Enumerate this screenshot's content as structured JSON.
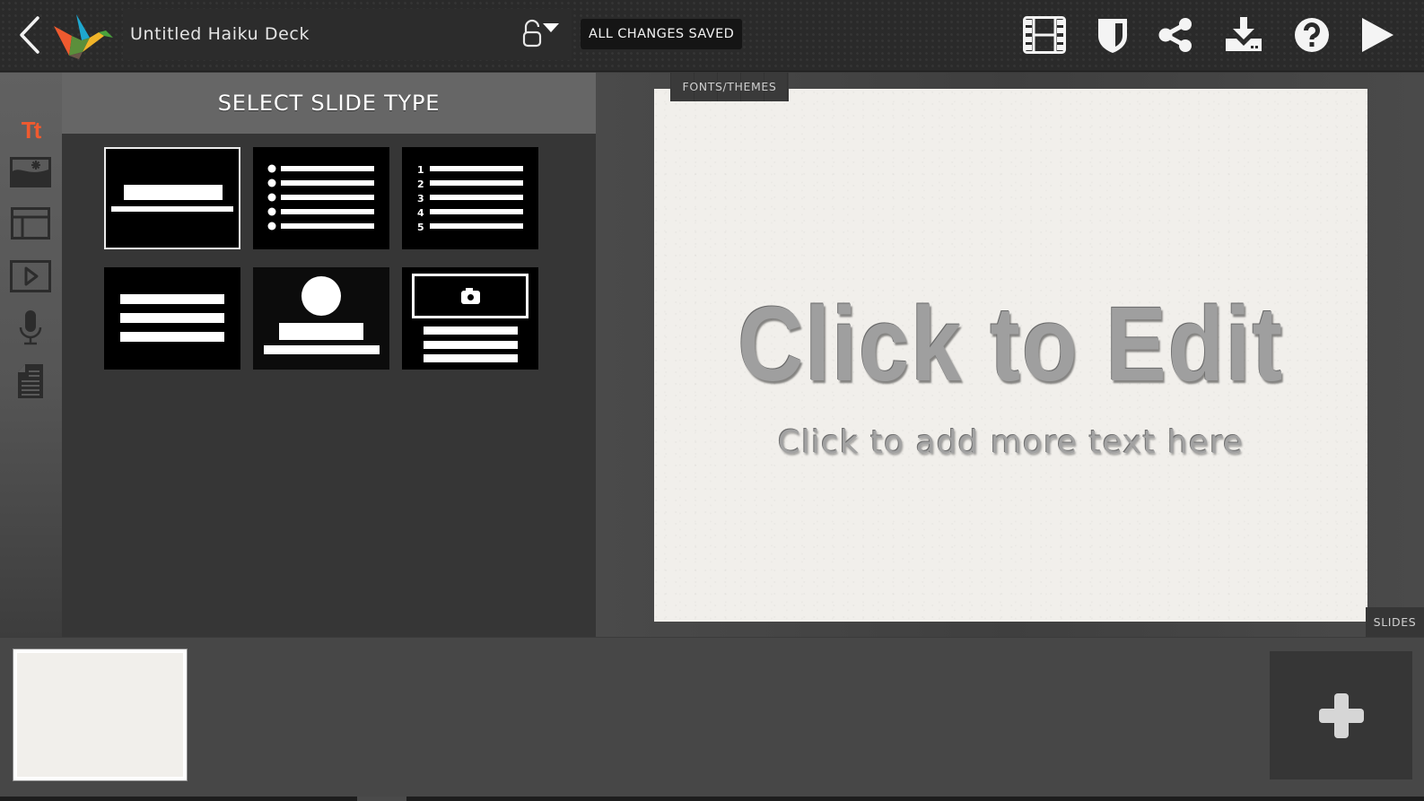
{
  "app": {
    "name": "Haiku Deck",
    "deck_title": "Untitled Haiku Deck",
    "save_status": "ALL CHANGES SAVED"
  },
  "toolbar": {
    "left": [
      {
        "icon": "back-chevron-icon",
        "label": "Back"
      },
      {
        "icon": "haiku-deck-logo-icon",
        "label": "Haiku Deck"
      },
      {
        "icon": "unlock-icon",
        "label": "Privacy"
      }
    ],
    "right": [
      {
        "icon": "film-icon",
        "label": "Slide sorter"
      },
      {
        "icon": "shield-icon",
        "label": "Privacy"
      },
      {
        "icon": "share-icon",
        "label": "Share"
      },
      {
        "icon": "download-icon",
        "label": "Download"
      },
      {
        "icon": "help-icon",
        "label": "Help"
      },
      {
        "icon": "play-icon",
        "label": "Play"
      }
    ]
  },
  "rail": {
    "items": [
      {
        "icon": "text-icon",
        "glyph": "Tt",
        "label": "Text",
        "active": true,
        "color": "#ef5a2f"
      },
      {
        "icon": "image-icon",
        "label": "Image",
        "active": false
      },
      {
        "icon": "layout-icon",
        "label": "Layout",
        "active": false
      },
      {
        "icon": "video-icon",
        "label": "Video",
        "active": false
      },
      {
        "icon": "microphone-icon",
        "label": "Audio",
        "active": false
      },
      {
        "icon": "notes-icon",
        "label": "Notes",
        "active": false
      }
    ]
  },
  "panel": {
    "title": "SELECT SLIDE TYPE",
    "slide_types": [
      {
        "id": "title",
        "label": "Title",
        "selected": true
      },
      {
        "id": "bullets",
        "label": "Bulleted list",
        "selected": false
      },
      {
        "id": "numbered",
        "label": "Numbered list",
        "selected": false,
        "numbers": [
          "1",
          "2",
          "3",
          "4",
          "5"
        ]
      },
      {
        "id": "text",
        "label": "Text",
        "selected": false
      },
      {
        "id": "profile",
        "label": "Profile",
        "selected": false
      },
      {
        "id": "photo-caption",
        "label": "Photo with text",
        "selected": false
      }
    ]
  },
  "editor": {
    "fonts_tab": "FONTS/THEMES",
    "slides_tab": "SLIDES",
    "slide": {
      "title": "Click to Edit",
      "subtitle": "Click to add more text here"
    }
  },
  "filmstrip": {
    "slides": [
      {
        "index": 1,
        "selected": true
      }
    ],
    "add_label": "Add slide"
  },
  "colors": {
    "accent": "#ef5a2f",
    "topbar": "#2a2a2a",
    "panel": "#363636",
    "panel_header": "#666666",
    "slide_bg": "#f1efeb",
    "slide_text": "#9f9f9f"
  }
}
